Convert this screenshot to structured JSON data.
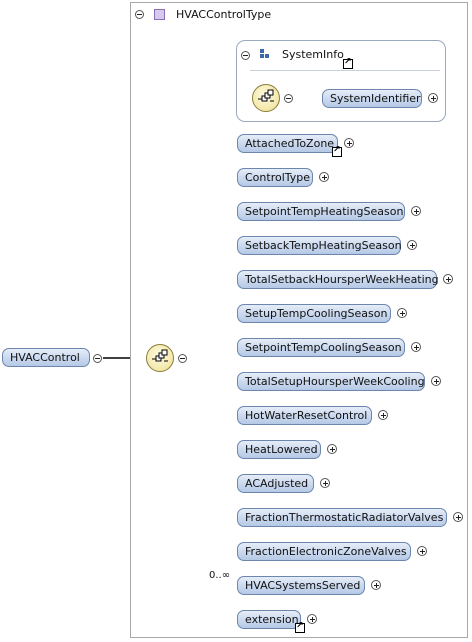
{
  "complex_type": {
    "label": "HVACControlType"
  },
  "group": {
    "label": "SystemInfo",
    "child": "SystemIdentifier"
  },
  "root": {
    "label": "HVACControl"
  },
  "elements": [
    {
      "label": "AttachedToZone",
      "ref": true
    },
    {
      "label": "ControlType"
    },
    {
      "label": "SetpointTempHeatingSeason"
    },
    {
      "label": "SetbackTempHeatingSeason"
    },
    {
      "label": "TotalSetbackHoursperWeekHeating"
    },
    {
      "label": "SetupTempCoolingSeason"
    },
    {
      "label": "SetpointTempCoolingSeason"
    },
    {
      "label": "TotalSetupHoursperWeekCooling"
    },
    {
      "label": "HotWaterResetControl"
    },
    {
      "label": "HeatLowered"
    },
    {
      "label": "ACAdjusted"
    },
    {
      "label": "FractionThermostaticRadiatorValves"
    },
    {
      "label": "FractionElectronicZoneValves"
    },
    {
      "label": "HVACSystemsServed",
      "cardinality": "0..∞"
    },
    {
      "label": "extension",
      "ref": true
    }
  ]
}
